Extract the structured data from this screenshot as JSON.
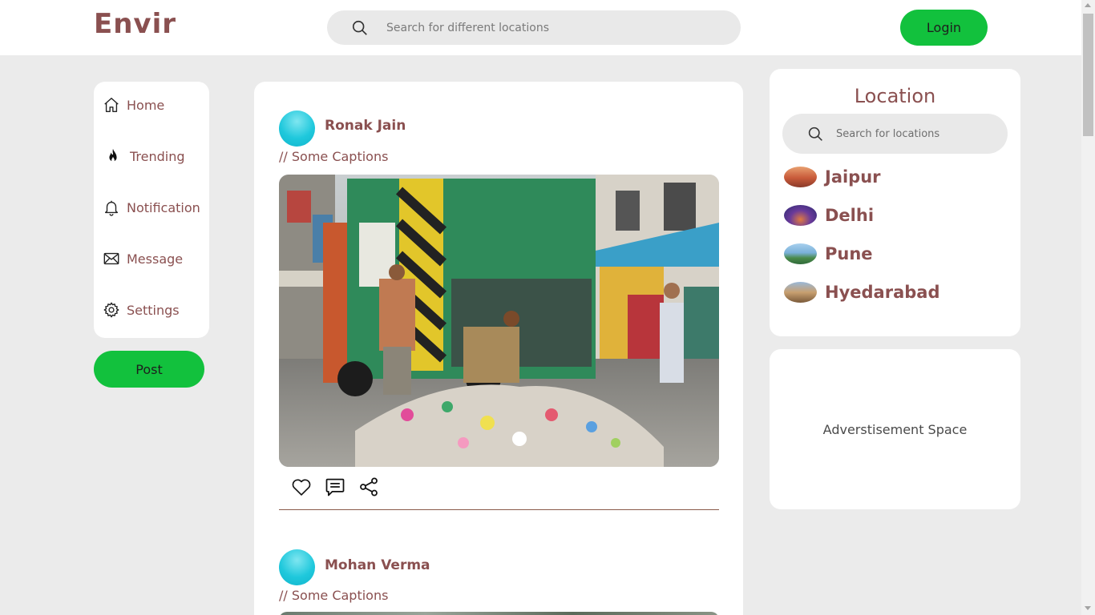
{
  "header": {
    "brand": "Envir",
    "search_placeholder": "Search for different locations",
    "login_label": "Login"
  },
  "nav": {
    "items": [
      {
        "label": "Home",
        "icon": "home-icon"
      },
      {
        "label": "Trending",
        "icon": "flame-icon"
      },
      {
        "label": "Notification",
        "icon": "bell-icon"
      },
      {
        "label": "Message",
        "icon": "envelope-icon"
      },
      {
        "label": "Settings",
        "icon": "gear-icon"
      }
    ],
    "post_label": "Post"
  },
  "feed": {
    "posts": [
      {
        "author": "Ronak Jain",
        "caption": "// Some Captions",
        "image": "garbage-truck-street-photo"
      },
      {
        "author": "Mohan Verma",
        "caption": "// Some Captions"
      }
    ],
    "actions": [
      "heart-icon",
      "comment-icon",
      "share-icon"
    ]
  },
  "locations": {
    "title": "Location",
    "search_placeholder": "Search for locations",
    "items": [
      {
        "name": "Jaipur"
      },
      {
        "name": "Delhi"
      },
      {
        "name": "Pune"
      },
      {
        "name": "Hyedarabad"
      }
    ]
  },
  "ad": {
    "label": "Adverstisement Space"
  },
  "colors": {
    "accent_green": "#12c13d",
    "text_brown": "#8a5050",
    "background": "#ebebeb"
  }
}
